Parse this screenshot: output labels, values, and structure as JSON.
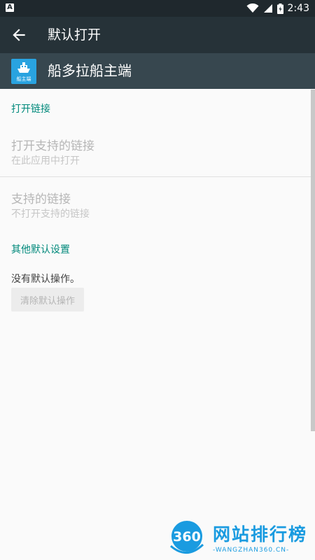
{
  "status_bar": {
    "left_icon_letter": "A",
    "time": "2:43",
    "icons": [
      "wifi-icon",
      "signal-icon",
      "battery-icon"
    ]
  },
  "app_bar": {
    "title": "默认打开",
    "back_icon": "arrow-back-icon"
  },
  "app_info": {
    "name": "船多拉船主端",
    "icon_caption": "船主端"
  },
  "sections": {
    "open_links": {
      "header": "打开链接",
      "open_supported": {
        "title": "打开支持的链接",
        "summary": "在此应用中打开"
      },
      "supported_links": {
        "title": "支持的链接",
        "summary": "不打开支持的链接"
      }
    },
    "other_defaults": {
      "header": "其他默认设置",
      "no_default_text": "没有默认操作。",
      "clear_button": "清除默认操作"
    }
  },
  "watermark": {
    "logo_text": "360",
    "title": "网站排行榜",
    "subtitle": "-WANGZHAN360.CN-"
  },
  "colors": {
    "accent": "#00897b",
    "appbar": "#263238",
    "app_row": "#37474f",
    "status_bar": "#1f282d",
    "watermark": "#1a9be0"
  }
}
